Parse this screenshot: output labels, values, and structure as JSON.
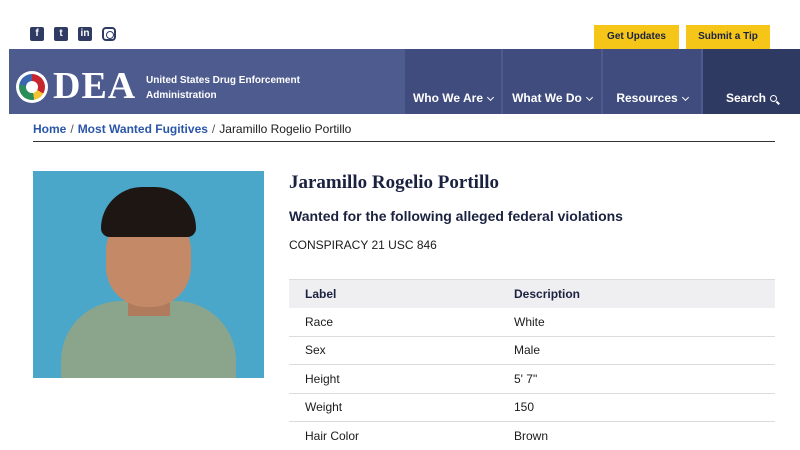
{
  "social": [
    "facebook-icon",
    "twitter-icon",
    "linkedin-icon",
    "instagram-icon"
  ],
  "utility": {
    "updates_label": "Get Updates",
    "tip_label": "Submit a Tip"
  },
  "header": {
    "wordmark": "DEA",
    "agency": "United States Drug Enforcement Administration",
    "nav": [
      {
        "label": "Who We Are"
      },
      {
        "label": "What We Do"
      },
      {
        "label": "Resources"
      },
      {
        "label": "Search"
      }
    ]
  },
  "breadcrumb": {
    "home": "Home",
    "section": "Most Wanted Fugitives",
    "current": "Jaramillo Rogelio Portillo"
  },
  "profile": {
    "name": "Jaramillo Rogelio Portillo",
    "subhead": "Wanted for the following alleged federal violations",
    "charge": "CONSPIRACY 21 USC 846"
  },
  "table": {
    "headers": [
      "Label",
      "Description"
    ],
    "rows": [
      [
        "Race",
        "White"
      ],
      [
        "Sex",
        "Male"
      ],
      [
        "Height",
        "5' 7\""
      ],
      [
        "Weight",
        "150"
      ],
      [
        "Hair Color",
        "Brown"
      ]
    ]
  },
  "colors": {
    "header": "#4d5b8f",
    "nav": "#3f4c7d",
    "accent": "#f5c518",
    "link": "#2a56a8"
  }
}
